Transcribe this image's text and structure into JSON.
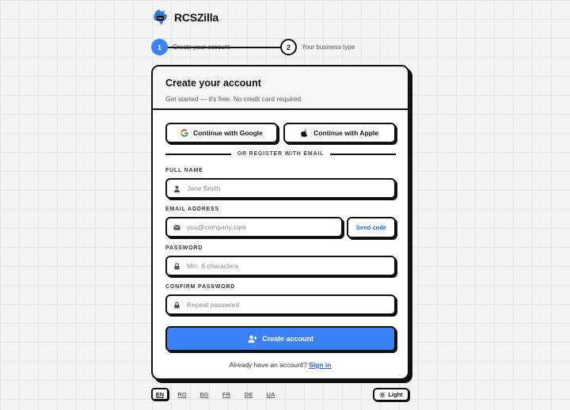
{
  "brand": {
    "name": "RCSZilla",
    "logo_icon": "dragon-chat-logo"
  },
  "stepper": {
    "steps": [
      {
        "number": "1",
        "label": "Create your account",
        "state": "active"
      },
      {
        "number": "2",
        "label": "Your business type",
        "state": "upcoming"
      }
    ]
  },
  "card": {
    "title": "Create your account",
    "subtitle": "Get started — it's free. No credit card required.",
    "social": {
      "google_label": "Continue with Google",
      "apple_label": "Continue with Apple"
    },
    "divider_text": "OR REGISTER WITH EMAIL",
    "fields": {
      "full_name": {
        "label": "FULL NAME",
        "placeholder": "Jane Smith",
        "icon": "user-icon"
      },
      "email": {
        "label": "EMAIL ADDRESS",
        "placeholder": "you@company.com",
        "icon": "envelope-icon"
      },
      "password": {
        "label": "PASSWORD",
        "placeholder": "Min. 8 characters",
        "icon": "lock-icon"
      },
      "confirm_password": {
        "label": "CONFIRM PASSWORD",
        "placeholder": "Repeat password",
        "icon": "lock-icon"
      }
    },
    "send_code_label": "Send code",
    "submit_label": "Create account",
    "signin_prompt": "Already have an account?",
    "signin_link": "Sign in"
  },
  "footer": {
    "languages": [
      {
        "code": "EN",
        "active": true
      },
      {
        "code": "RO",
        "active": false
      },
      {
        "code": "BG",
        "active": false
      },
      {
        "code": "FR",
        "active": false
      },
      {
        "code": "DE",
        "active": false
      },
      {
        "code": "UA",
        "active": false
      }
    ],
    "theme_label": "Light"
  },
  "colors": {
    "accent": "#3b82f6",
    "link": "#2563eb",
    "border": "#111111",
    "background": "#f4f4f4"
  }
}
